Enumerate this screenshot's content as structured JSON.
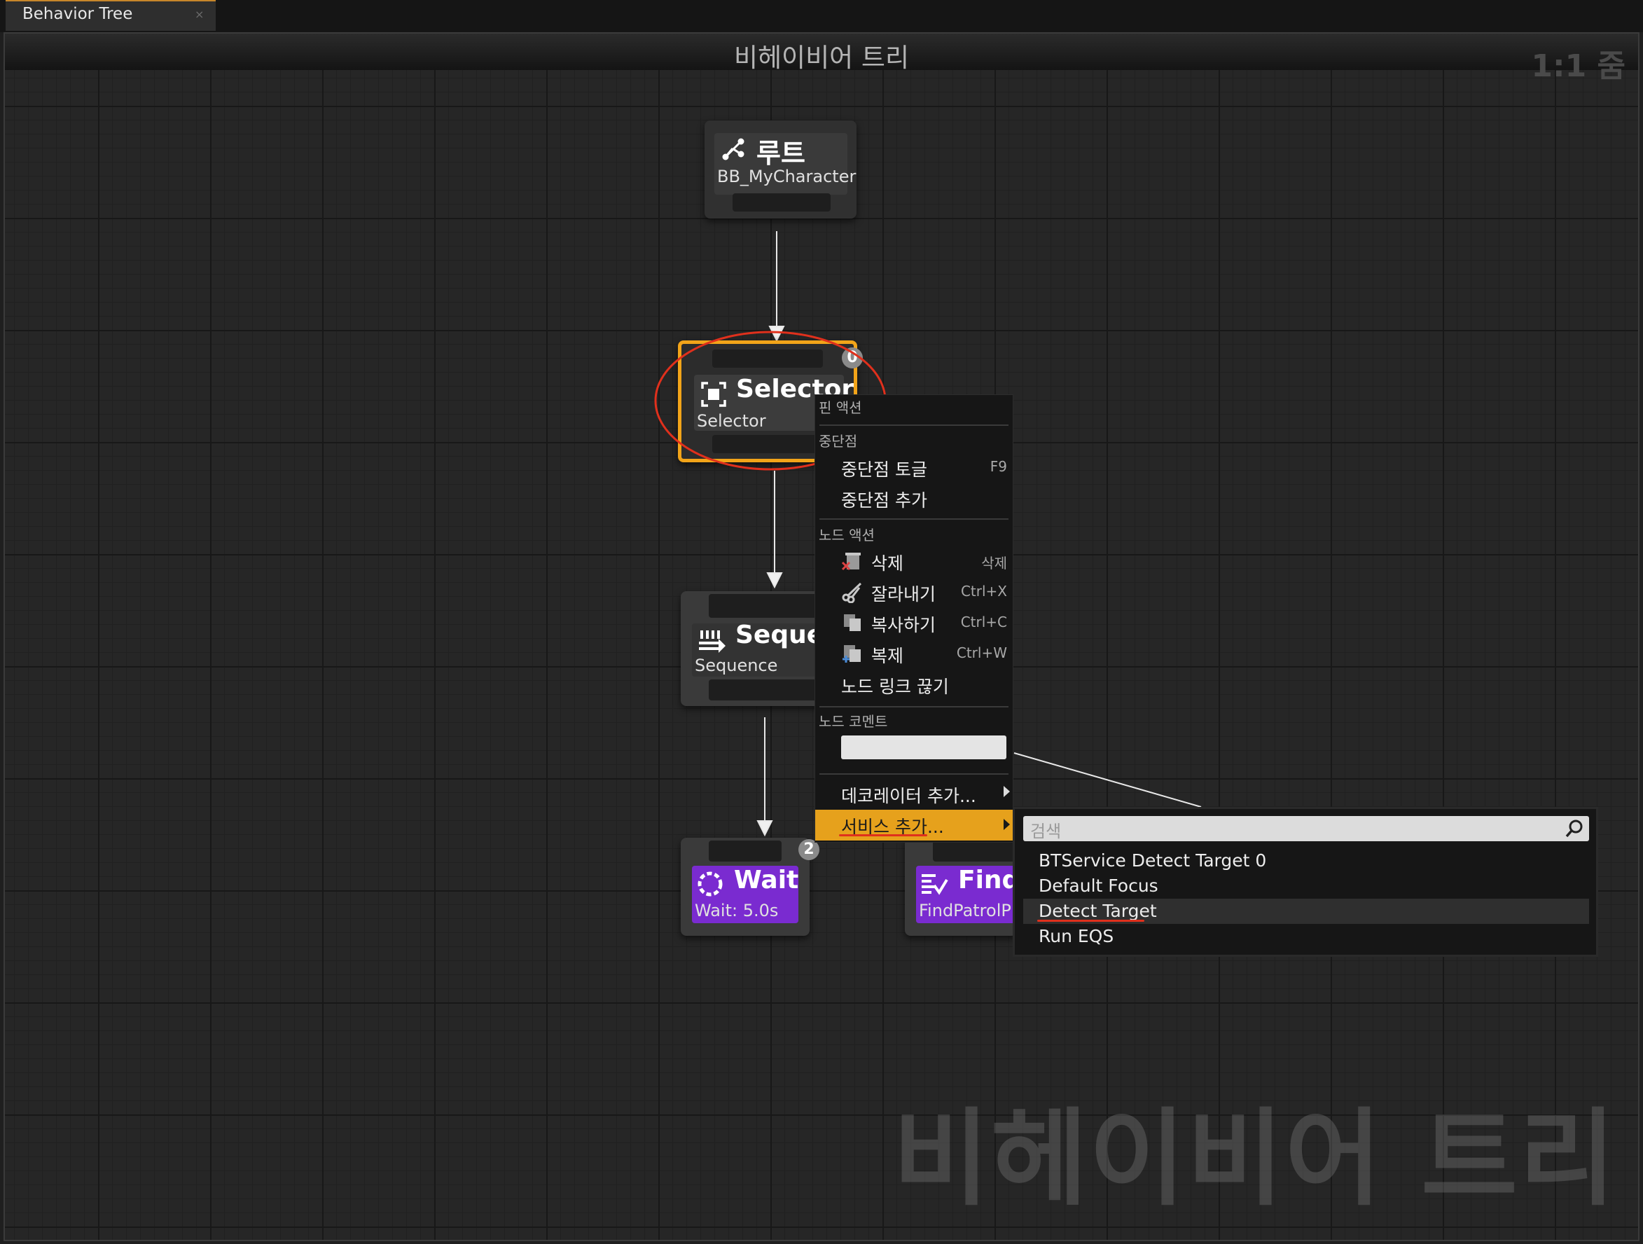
{
  "tab": {
    "title": "Behavior Tree",
    "close": "×"
  },
  "graph": {
    "title": "비헤이비어 트리",
    "zoom": "1:1 줌",
    "watermark": "비헤이비어 트리"
  },
  "nodes": {
    "root": {
      "title": "루트",
      "subtitle": "BB_MyCharacter"
    },
    "selector": {
      "title": "Selector",
      "subtitle": "Selector",
      "badge": "0"
    },
    "sequence": {
      "title": "Sequer",
      "subtitle": "Sequence"
    },
    "wait": {
      "title": "Wait",
      "subtitle": "Wait: 5.0s",
      "badge": "2"
    },
    "find": {
      "title": "Find",
      "subtitle": "FindPatrolP"
    }
  },
  "context_menu": {
    "header": "핀 액션",
    "breakpoint_section": "중단점",
    "toggle_breakpoint": {
      "label": "중단점 토글",
      "shortcut": "F9"
    },
    "add_breakpoint": {
      "label": "중단점 추가"
    },
    "node_actions_section": "노드 액션",
    "delete": {
      "label": "삭제",
      "shortcut": "삭제"
    },
    "cut": {
      "label": "잘라내기",
      "shortcut": "Ctrl+X"
    },
    "copy": {
      "label": "복사하기",
      "shortcut": "Ctrl+C"
    },
    "duplicate": {
      "label": "복제",
      "shortcut": "Ctrl+W"
    },
    "break_links": {
      "label": "노드 링크 끊기"
    },
    "node_comment_section": "노드 코멘트",
    "node_comment_value": "",
    "add_decorator": {
      "label": "데코레이터 추가..."
    },
    "add_service": {
      "label": "서비스 추가..."
    }
  },
  "service_submenu": {
    "search_placeholder": "검색",
    "items": [
      "BTService Detect Target 0",
      "Default Focus",
      "Detect Target",
      "Run EQS"
    ],
    "highlighted_index": 2
  },
  "colors": {
    "accent": "#e6a11c",
    "selection_border": "#f2a419",
    "annotation": "#e0301c",
    "task_node": "#7a2bd0"
  }
}
